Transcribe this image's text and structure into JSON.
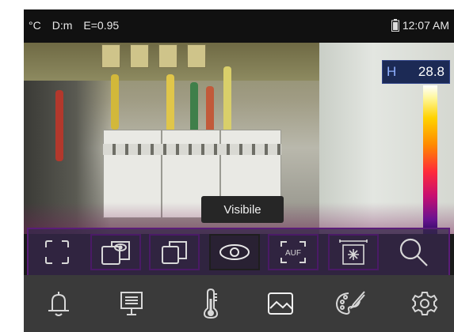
{
  "status": {
    "unit": "°C",
    "distance": "D:m",
    "emissivity": "E=0.95",
    "time": "12:07 AM",
    "battery_icon": "battery-icon"
  },
  "readout": {
    "label": "H",
    "value": "28.8"
  },
  "tooltip": "Visibile",
  "toolbar": {
    "tools": [
      {
        "icon": "fullscreen-icon"
      },
      {
        "icon": "picture-in-picture-icon"
      },
      {
        "icon": "overlay-icon"
      },
      {
        "icon": "visible-camera-icon"
      },
      {
        "icon": "auto-focus-icon"
      },
      {
        "icon": "center-point-icon"
      },
      {
        "icon": "zoom-icon"
      }
    ],
    "active_index": 3,
    "auto_focus_label": "AUF"
  },
  "bottom_nav": {
    "items": [
      {
        "icon": "bell-icon"
      },
      {
        "icon": "display-icon"
      },
      {
        "icon": "thermometer-icon"
      },
      {
        "icon": "image-icon"
      },
      {
        "icon": "palette-icon"
      },
      {
        "icon": "gear-icon"
      }
    ]
  },
  "colors": {
    "toolbar_border": "#5a1c78",
    "nav_background": "#3a3a3a",
    "readout_background": "#1c2a55"
  }
}
